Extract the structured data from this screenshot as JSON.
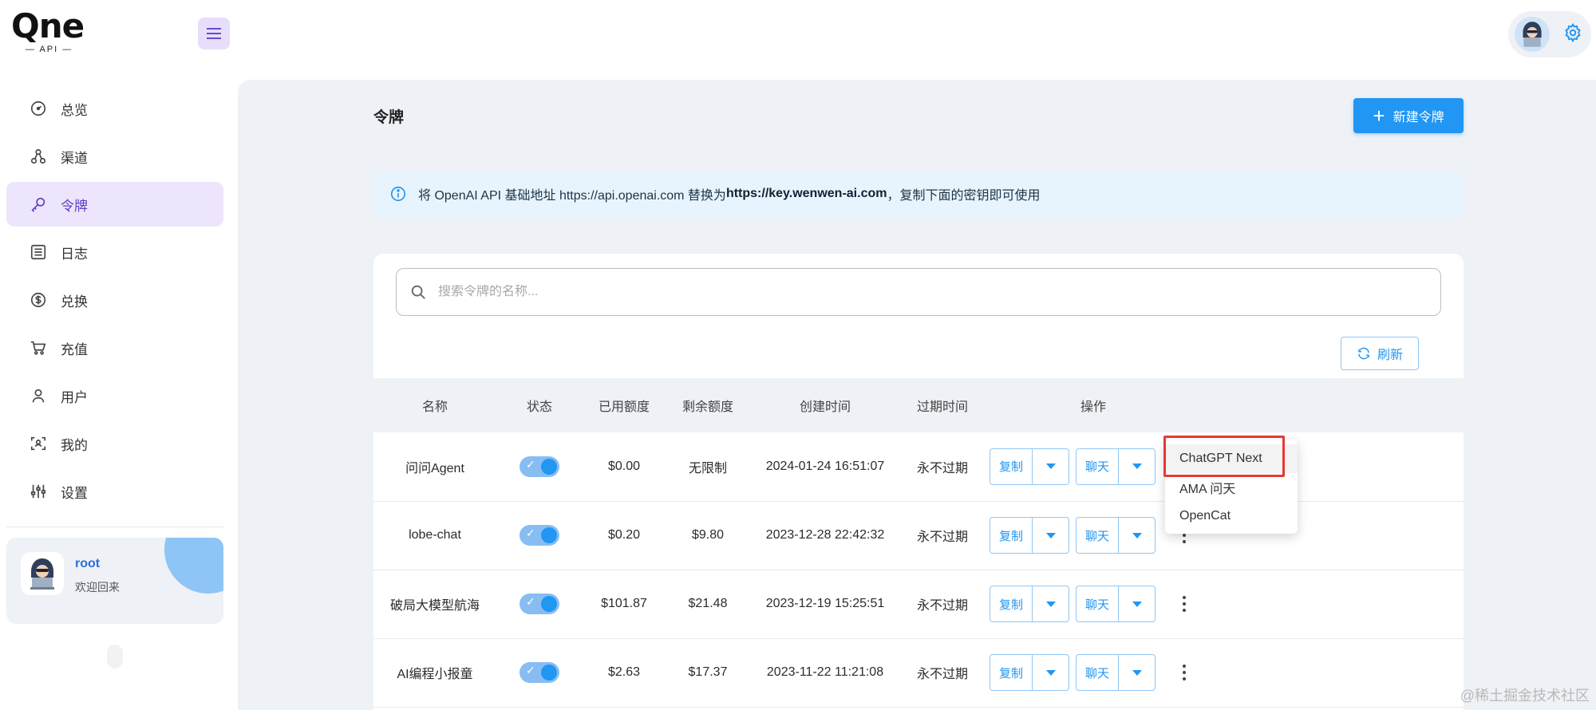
{
  "brand": {
    "logo_text": "Qne",
    "logo_sub": "— API —"
  },
  "sidebar": {
    "items": [
      {
        "label": "总览",
        "icon": "dashboard-icon"
      },
      {
        "label": "渠道",
        "icon": "channel-icon"
      },
      {
        "label": "令牌",
        "icon": "key-icon",
        "active": true
      },
      {
        "label": "日志",
        "icon": "log-icon"
      },
      {
        "label": "兑换",
        "icon": "dollar-icon"
      },
      {
        "label": "充值",
        "icon": "cart-icon"
      },
      {
        "label": "用户",
        "icon": "user-icon"
      },
      {
        "label": "我的",
        "icon": "profile-icon"
      },
      {
        "label": "设置",
        "icon": "settings-sliders-icon"
      }
    ],
    "user": {
      "name": "root",
      "welcome": "欢迎回来"
    }
  },
  "header": {
    "title": "令牌",
    "new_button": "新建令牌"
  },
  "alert": {
    "prefix": "将 OpenAI API 基础地址 https://api.openai.com 替换为 ",
    "url": "https://key.wenwen-ai.com",
    "suffix": "，复制下面的密钥即可使用"
  },
  "search": {
    "placeholder": "搜索令牌的名称..."
  },
  "refresh_label": "刷新",
  "table": {
    "columns": [
      "名称",
      "状态",
      "已用额度",
      "剩余额度",
      "创建时间",
      "过期时间",
      "操作"
    ],
    "rows": [
      {
        "name": "问问Agent",
        "enabled": true,
        "used": "$0.00",
        "remain": "无限制",
        "created": "2024-01-24 16:51:07",
        "expire": "永不过期"
      },
      {
        "name": "lobe-chat",
        "enabled": true,
        "used": "$0.20",
        "remain": "$9.80",
        "created": "2023-12-28 22:42:32",
        "expire": "永不过期"
      },
      {
        "name": "破局大模型航海",
        "enabled": true,
        "used": "$101.87",
        "remain": "$21.48",
        "created": "2023-12-19 15:25:51",
        "expire": "永不过期"
      },
      {
        "name": "AI编程小报童",
        "enabled": true,
        "used": "$2.63",
        "remain": "$17.37",
        "created": "2023-11-22 11:21:08",
        "expire": "永不过期"
      }
    ],
    "copy_label": "复制",
    "chat_label": "聊天"
  },
  "chat_menu": {
    "options": [
      "ChatGPT Next",
      "AMA 问天",
      "OpenCat"
    ],
    "highlighted": "ChatGPT Next"
  },
  "watermark": "@稀土掘金技术社区",
  "colors": {
    "primary": "#2196f3",
    "active_nav_bg": "#ede5fb",
    "active_nav_text": "#5b3ec2",
    "highlight_border": "#e53935",
    "main_bg": "#eef1f5"
  }
}
